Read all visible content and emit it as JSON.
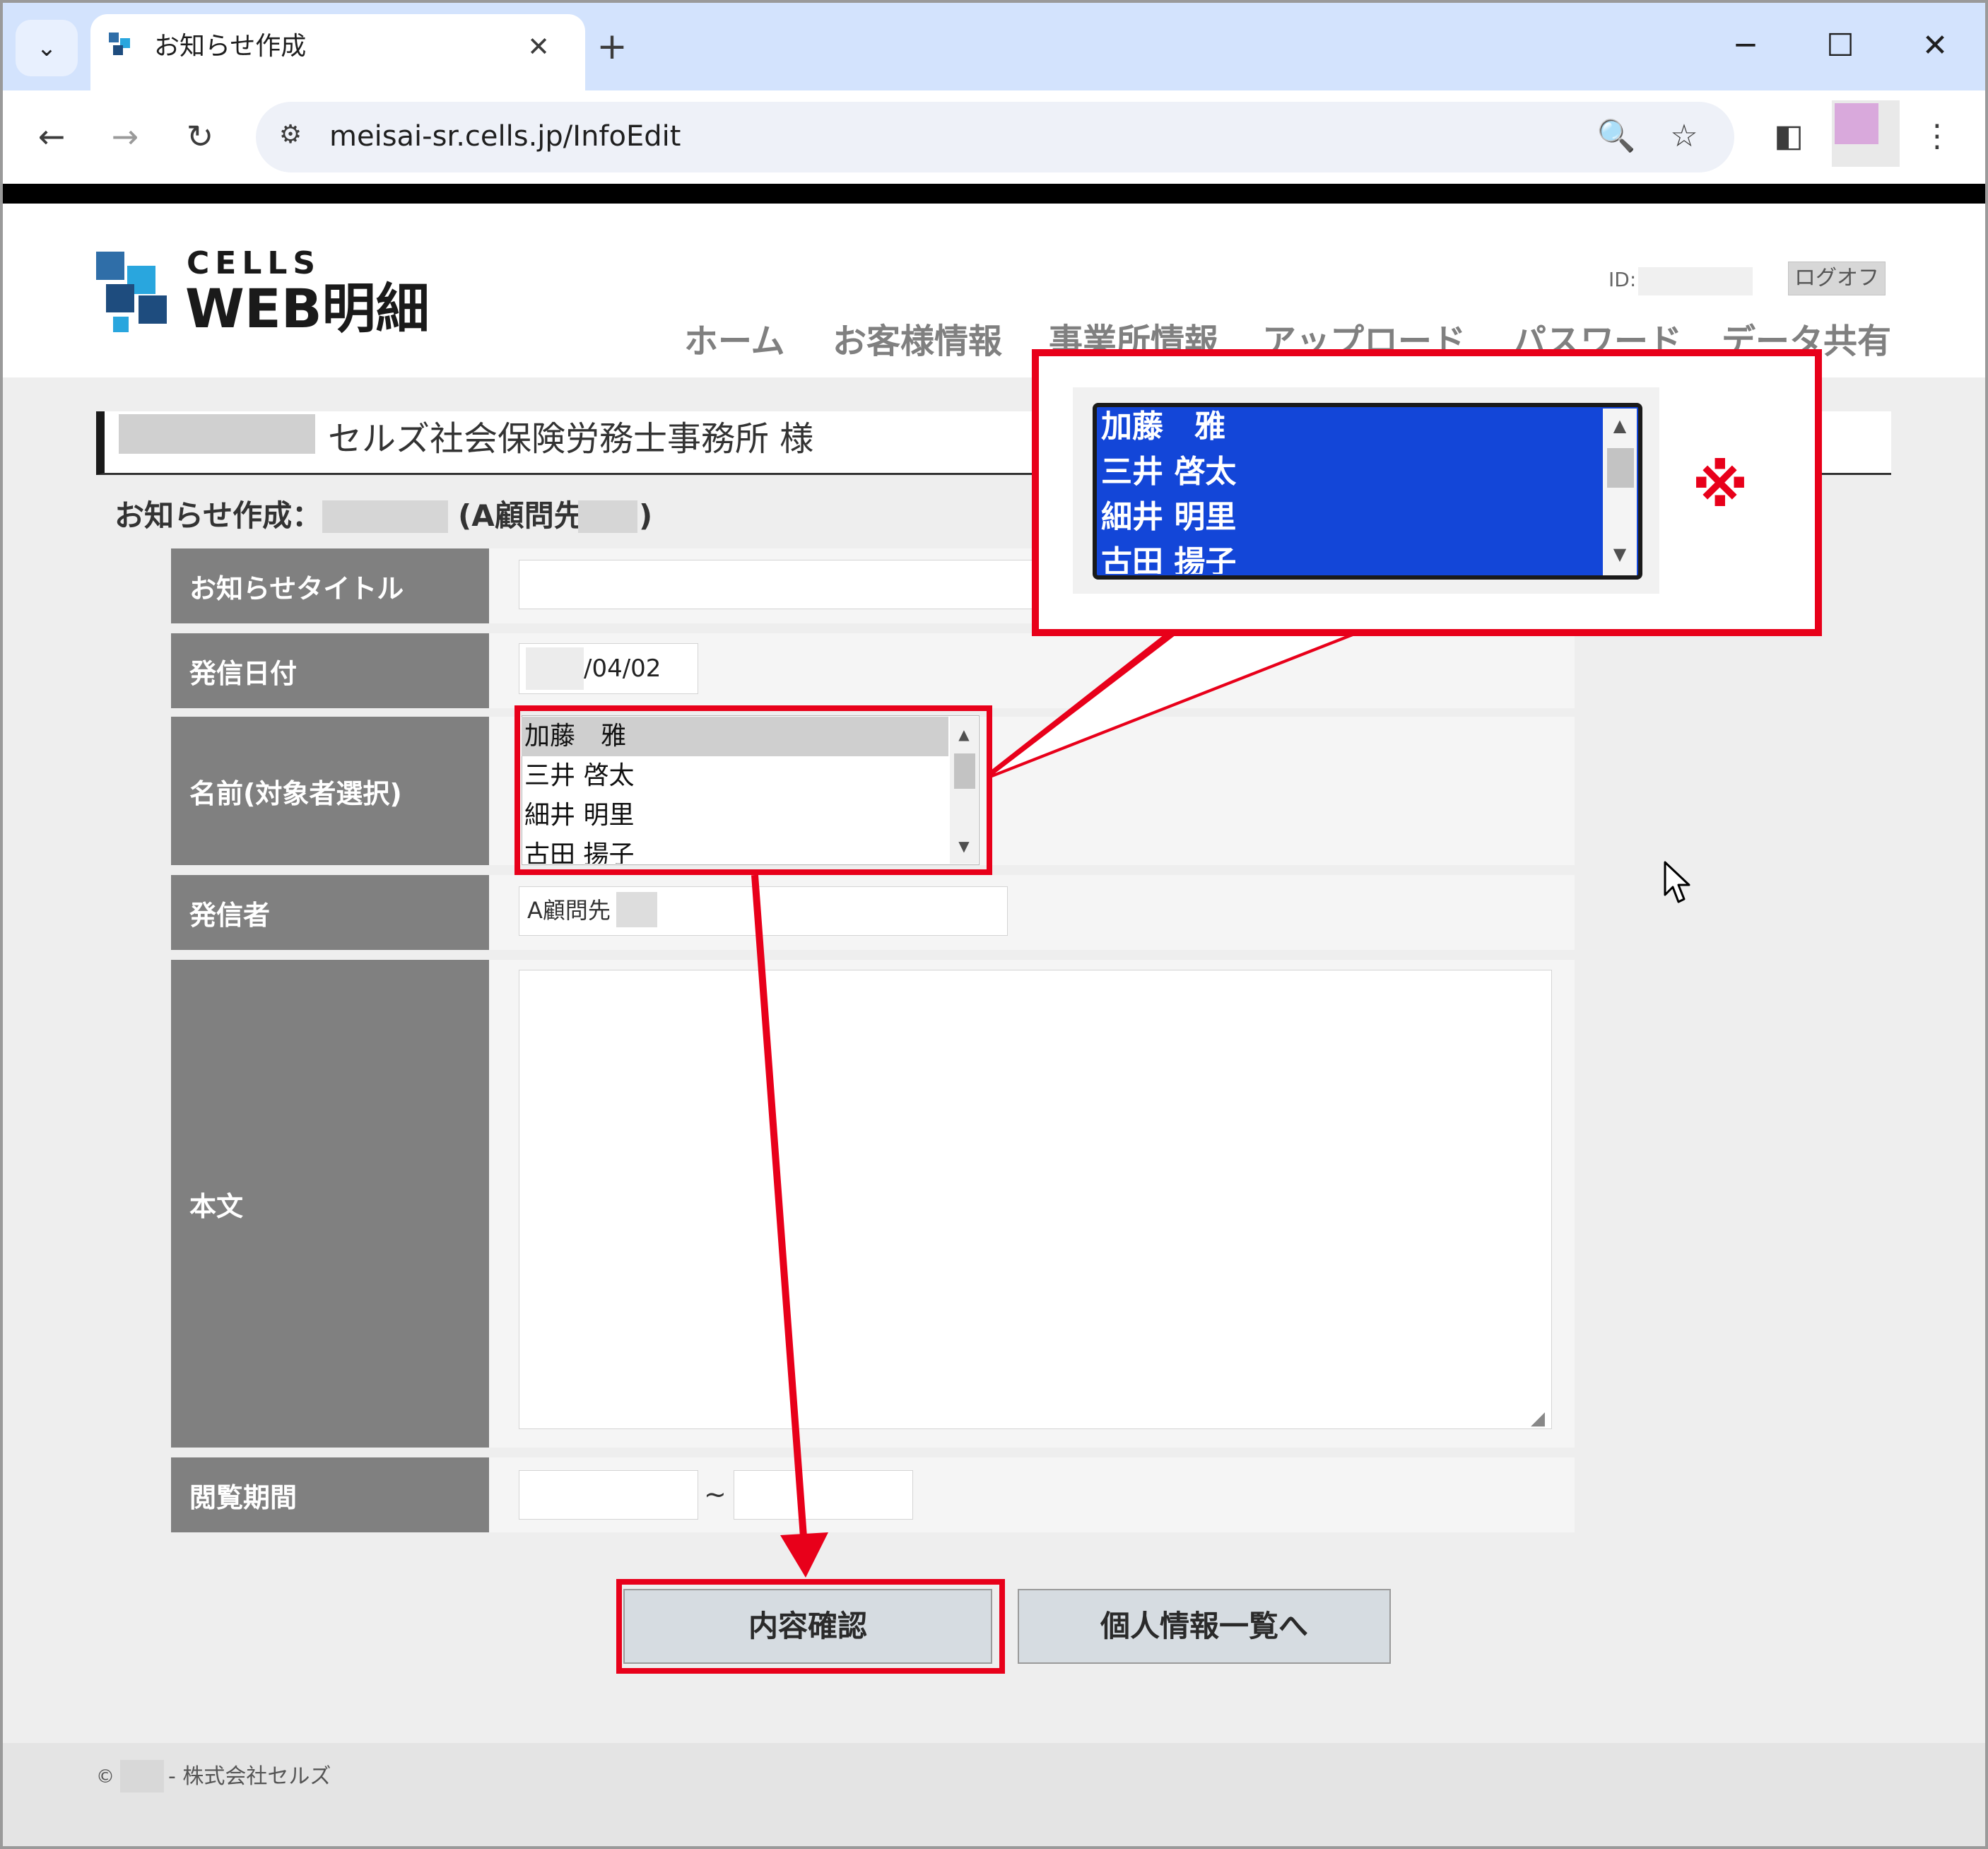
{
  "browser": {
    "tab_title": "お知らせ作成",
    "tab_close": "✕",
    "new_tab": "+",
    "url": "meisai-sr.cells.jp/InfoEdit",
    "controls": {
      "minimize": "─",
      "maximize": "☐",
      "close": "✕"
    },
    "nav": {
      "back": "←",
      "forward": "→",
      "reload": "↻"
    },
    "icons": {
      "dropdown": "⌄",
      "site_info": "⚙",
      "zoom": "🔍",
      "star": "☆",
      "sidepanel": "◧",
      "menu": "⋮"
    }
  },
  "site": {
    "logo_cells": "CELLS",
    "logo_web": "WEB明細",
    "id_label": "ID:",
    "logoff": "ログオフ",
    "menu": [
      "ホーム",
      "お客様情報",
      "事業所情報",
      "アップロード",
      "パスワード",
      "データ共有"
    ]
  },
  "page": {
    "office_name": "セルズ社会保険労務士事務所 様",
    "heading": "お知らせ作成：",
    "heading_client": "(A顧問先",
    "heading_close": ")"
  },
  "form": {
    "labels": {
      "title": "お知らせタイトル",
      "date": "発信日付",
      "names": "名前(対象者選択)",
      "sender": "発信者",
      "body": "本文",
      "period": "閲覧期間"
    },
    "date_value": "/04/02",
    "names_options": [
      "加藤　雅",
      "三井 啓太",
      "細井 明里",
      "古田 揚子"
    ],
    "sender_value": "A顧問先",
    "period_separator": "~",
    "resize_glyph": "◢"
  },
  "buttons": {
    "confirm": "内容確認",
    "back_to_list": "個人情報一覧へ"
  },
  "footer": {
    "symbol": "©",
    "text": "- 株式会社セルズ"
  },
  "callout": {
    "zoom_options": [
      "加藤　雅",
      "三井 啓太",
      "細井 明里",
      "古田 揚子"
    ],
    "note_mark": "※"
  },
  "colors": {
    "annotation_red": "#e8001a",
    "selected_blue": "#1346d8",
    "label_gray": "#808080",
    "tab_strip": "#d3e3fd"
  }
}
